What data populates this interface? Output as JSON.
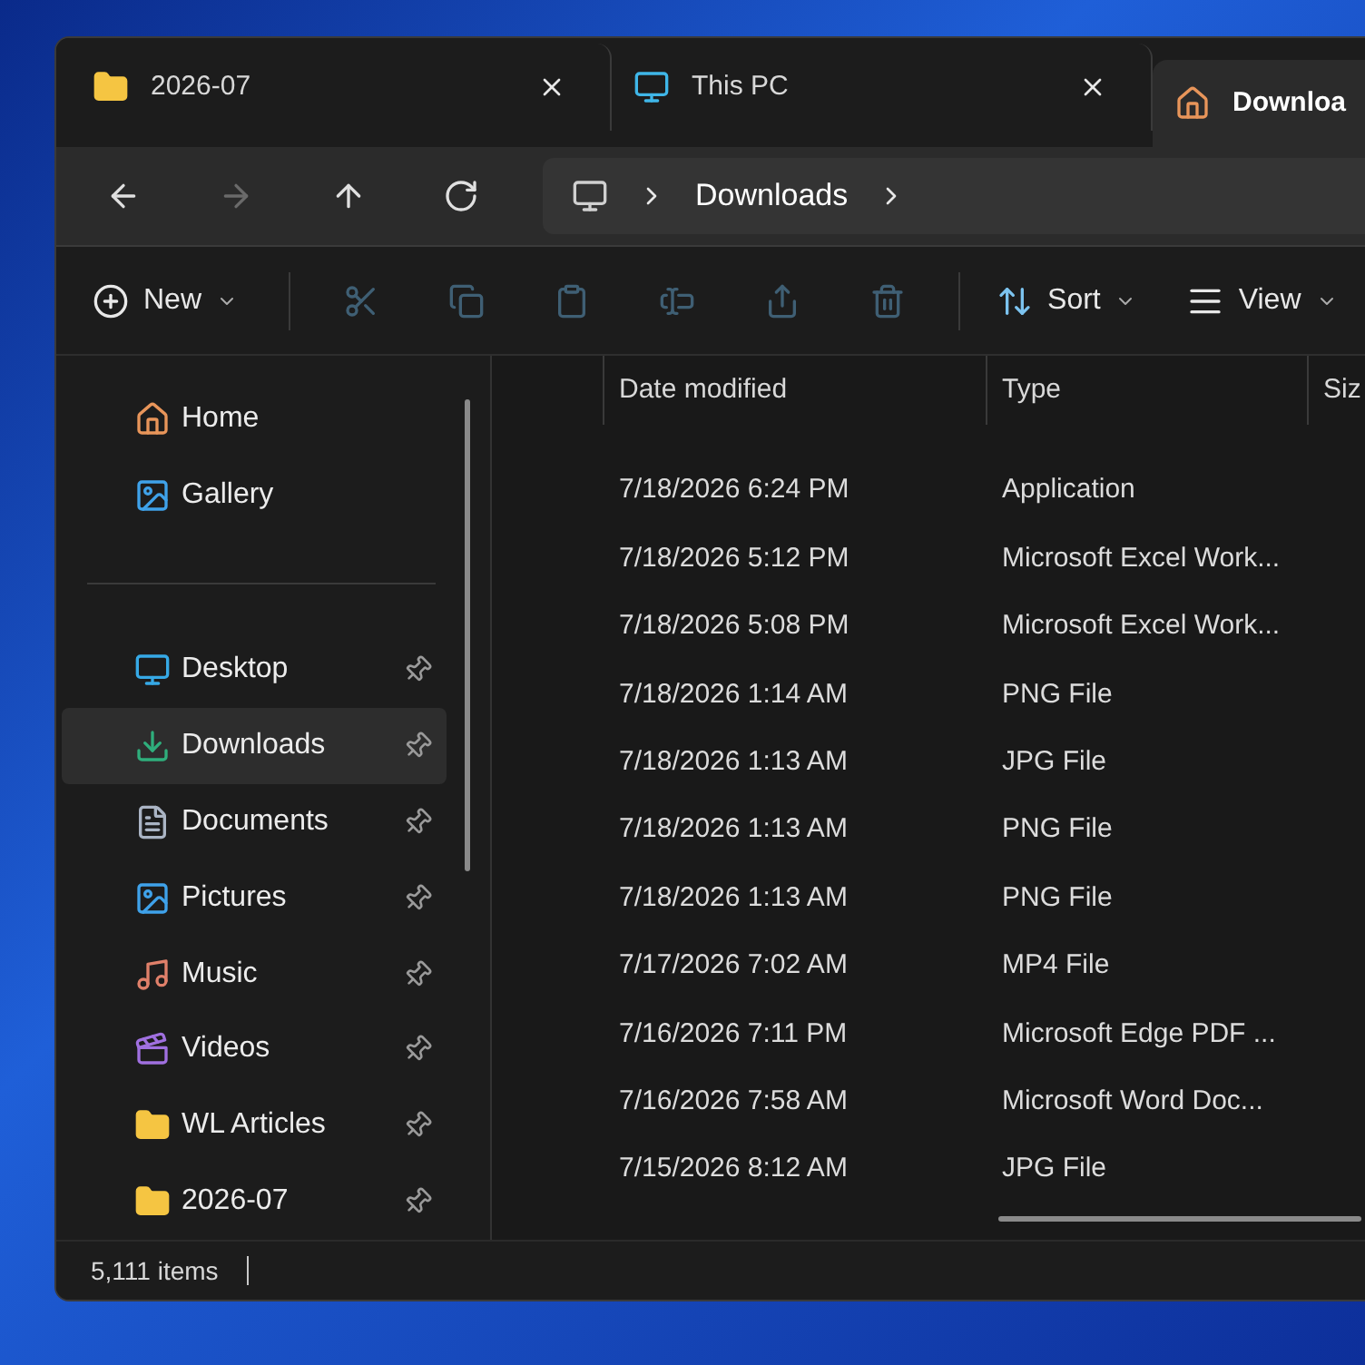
{
  "tabs": [
    {
      "label": "2026-07",
      "kind": "folder",
      "selected": false,
      "closable": true
    },
    {
      "label": "This PC",
      "kind": "pc",
      "selected": false,
      "closable": true
    },
    {
      "label": "Downloa",
      "kind": "home",
      "selected": true,
      "closable": false
    }
  ],
  "nav_buttons": [
    {
      "kind": "back",
      "disabled": false
    },
    {
      "kind": "forward",
      "disabled": true
    },
    {
      "kind": "up",
      "disabled": false
    },
    {
      "kind": "refresh",
      "disabled": false
    }
  ],
  "breadcrumb": {
    "items": [
      "Downloads"
    ]
  },
  "toolbar": [
    {
      "kind": "new",
      "label": "New",
      "disabled": false
    },
    {
      "kind": "cut",
      "disabled": true
    },
    {
      "kind": "copy",
      "disabled": true
    },
    {
      "kind": "paste",
      "disabled": true
    },
    {
      "kind": "rename",
      "disabled": true
    },
    {
      "kind": "share",
      "disabled": true
    },
    {
      "kind": "delete",
      "disabled": true
    },
    {
      "kind": "sort",
      "label": "Sort",
      "disabled": false
    },
    {
      "kind": "view",
      "label": "View",
      "disabled": false
    }
  ],
  "sidebar": {
    "groups": [
      [
        {
          "label": "Home",
          "kind": "home",
          "pinned": false,
          "selected": false
        },
        {
          "label": "Gallery",
          "kind": "gallery",
          "pinned": false,
          "selected": false
        }
      ],
      [
        {
          "label": "Desktop",
          "kind": "desktop",
          "pinned": true,
          "selected": false
        },
        {
          "label": "Downloads",
          "kind": "downloads",
          "pinned": true,
          "selected": true
        },
        {
          "label": "Documents",
          "kind": "documents",
          "pinned": true,
          "selected": false
        },
        {
          "label": "Pictures",
          "kind": "pictures",
          "pinned": true,
          "selected": false
        },
        {
          "label": "Music",
          "kind": "music",
          "pinned": true,
          "selected": false
        },
        {
          "label": "Videos",
          "kind": "videos",
          "pinned": true,
          "selected": false
        },
        {
          "label": "WL Articles",
          "kind": "folder",
          "pinned": true,
          "selected": false
        },
        {
          "label": "2026-07",
          "kind": "folder",
          "pinned": true,
          "selected": false
        }
      ]
    ]
  },
  "table": {
    "columns": [
      "Date modified",
      "Type",
      "Siz"
    ],
    "rows": [
      [
        "7/18/2026 6:24 PM",
        "Application"
      ],
      [
        "7/18/2026 5:12 PM",
        "Microsoft Excel Work..."
      ],
      [
        "7/18/2026 5:08 PM",
        "Microsoft Excel Work..."
      ],
      [
        "7/18/2026 1:14 AM",
        "PNG File"
      ],
      [
        "7/18/2026 1:13 AM",
        "JPG File"
      ],
      [
        "7/18/2026 1:13 AM",
        "PNG File"
      ],
      [
        "7/18/2026 1:13 AM",
        "PNG File"
      ],
      [
        "7/17/2026 7:02 AM",
        "MP4 File"
      ],
      [
        "7/16/2026 7:11 PM",
        "Microsoft Edge PDF ..."
      ],
      [
        "7/16/2026 7:58 AM",
        "Microsoft Word Doc..."
      ],
      [
        "7/15/2026 8:12 AM",
        "JPG File"
      ]
    ]
  },
  "status_bar": {
    "item_count": "5,111 items"
  }
}
